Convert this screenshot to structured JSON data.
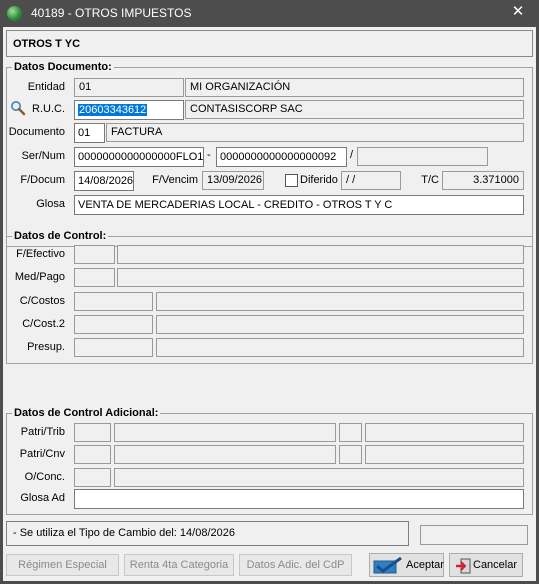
{
  "window": {
    "title": "40189 - OTROS IMPUESTOS",
    "close_glyph": "✕"
  },
  "header": {
    "title": "OTROS T YC"
  },
  "datos_documento": {
    "legend": "Datos Documento:",
    "entidad": {
      "label": "Entidad",
      "code": "01",
      "name": "MI ORGANIZACIÓN"
    },
    "ruc": {
      "label": "R.U.C.",
      "value": "20603343612",
      "name": "CONTASISCORP SAC"
    },
    "documento": {
      "label": "Documento",
      "code": "01",
      "name": "FACTURA"
    },
    "sernum": {
      "label": "Ser/Num",
      "serie": "0000000000000000FLO1",
      "dash": "-",
      "numero": "0000000000000000092",
      "slash": "/",
      "extra": ""
    },
    "fdocum": {
      "label": "F/Docum",
      "value": "14/08/2026"
    },
    "fvencim": {
      "label": "F/Vencim",
      "value": "13/09/2026"
    },
    "diferido": {
      "label": "Diferido",
      "value": " /  /",
      "checked": false
    },
    "tc": {
      "label": "T/C",
      "value": "3.371000"
    },
    "glosa": {
      "label": "Glosa",
      "value": "VENTA DE MERCADERIAS LOCAL - CREDITO - OTROS T Y C"
    }
  },
  "datos_control": {
    "legend": "Datos de Control:",
    "fields": [
      {
        "label": "F/Efectivo"
      },
      {
        "label": "Med/Pago"
      },
      {
        "label": "C/Costos"
      },
      {
        "label": "C/Cost.2"
      },
      {
        "label": "Presup."
      }
    ]
  },
  "datos_control_adicional": {
    "legend": "Datos de Control Adicional:",
    "fields": [
      {
        "label": "Patri/Trib"
      },
      {
        "label": "Patri/Cnv"
      },
      {
        "label": "O/Conc."
      },
      {
        "label": "Glosa Ad"
      }
    ]
  },
  "status": {
    "message": "- Se utiliza el Tipo de Cambio del: 14/08/2026"
  },
  "buttons": {
    "regimen": "Régimen Especial",
    "renta": "Renta 4ta Categoria",
    "datos_adic": "Datos Adic. del CdP",
    "aceptar": "Aceptar",
    "cancelar": "Cancelar"
  },
  "icons": {
    "search": "search-icon",
    "accept": "check-icon",
    "cancel": "exit-icon",
    "app": "app-icon"
  }
}
